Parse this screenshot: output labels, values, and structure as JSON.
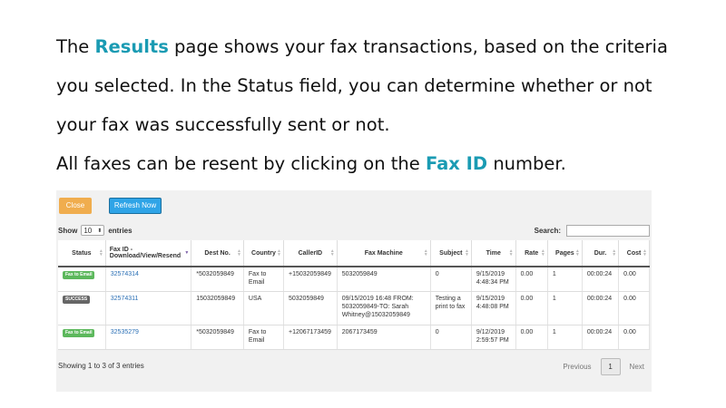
{
  "slide": {
    "line1_pre": "The ",
    "line1_hl": "Results",
    "line1_post": " page shows your fax transactions, based on the criteria",
    "line2": "you selected. In the Status field, you can determine whether or not",
    "line3": "your fax was successfully sent or not.",
    "line4_pre": "All faxes can be resent by clicking on the ",
    "line4_hl": "Fax ID",
    "line4_post": " number.",
    "highlight_color": "#1a9bb3"
  },
  "toolbar": {
    "close_label": "Close",
    "refresh_label": "Refresh Now"
  },
  "length": {
    "show_label": "Show",
    "value": "10",
    "entries_label": "entries"
  },
  "search": {
    "label": "Search:",
    "value": ""
  },
  "table": {
    "headers": {
      "status": "Status",
      "faxid_1": "Fax ID -",
      "faxid_2": "Download/View/Resend",
      "dest": "Dest No.",
      "country": "Country",
      "callerid": "CallerID",
      "faxmachine": "Fax Machine",
      "subject": "Subject",
      "time": "Time",
      "rate": "Rate",
      "pages": "Pages",
      "dur": "Dur.",
      "cost": "Cost"
    },
    "rows": [
      {
        "status": "Fax to Email",
        "fax_id": "32574314",
        "dest": "*5032059849",
        "country": "Fax to Email",
        "callerid": "+15032059849",
        "fax_machine": "5032059849",
        "subject": "0",
        "time": "9/15/2019 4:48:34 PM",
        "rate": "0.00",
        "pages": "1",
        "dur": "00:00:24",
        "cost": "0.00"
      },
      {
        "status": "SUCCESS",
        "fax_id": "32574311",
        "dest": "15032059849",
        "country": "USA",
        "callerid": "5032059849",
        "fax_machine": "09/15/2019 16:48 FROM: 5032059849-TO: Sarah Whitney@15032059849",
        "subject": "Testing a print to fax",
        "time": "9/15/2019 4:48:08 PM",
        "rate": "0.00",
        "pages": "1",
        "dur": "00:00:24",
        "cost": "0.00"
      },
      {
        "status": "Fax to Email",
        "fax_id": "32535279",
        "dest": "*5032059849",
        "country": "Fax to Email",
        "callerid": "+12067173459",
        "fax_machine": "2067173459",
        "subject": "0",
        "time": "9/12/2019 2:59:57 PM",
        "rate": "0.00",
        "pages": "1",
        "dur": "00:00:24",
        "cost": "0.00"
      }
    ]
  },
  "footer": {
    "info": "Showing 1 to 3 of 3 entries",
    "previous": "Previous",
    "page": "1",
    "next": "Next"
  }
}
